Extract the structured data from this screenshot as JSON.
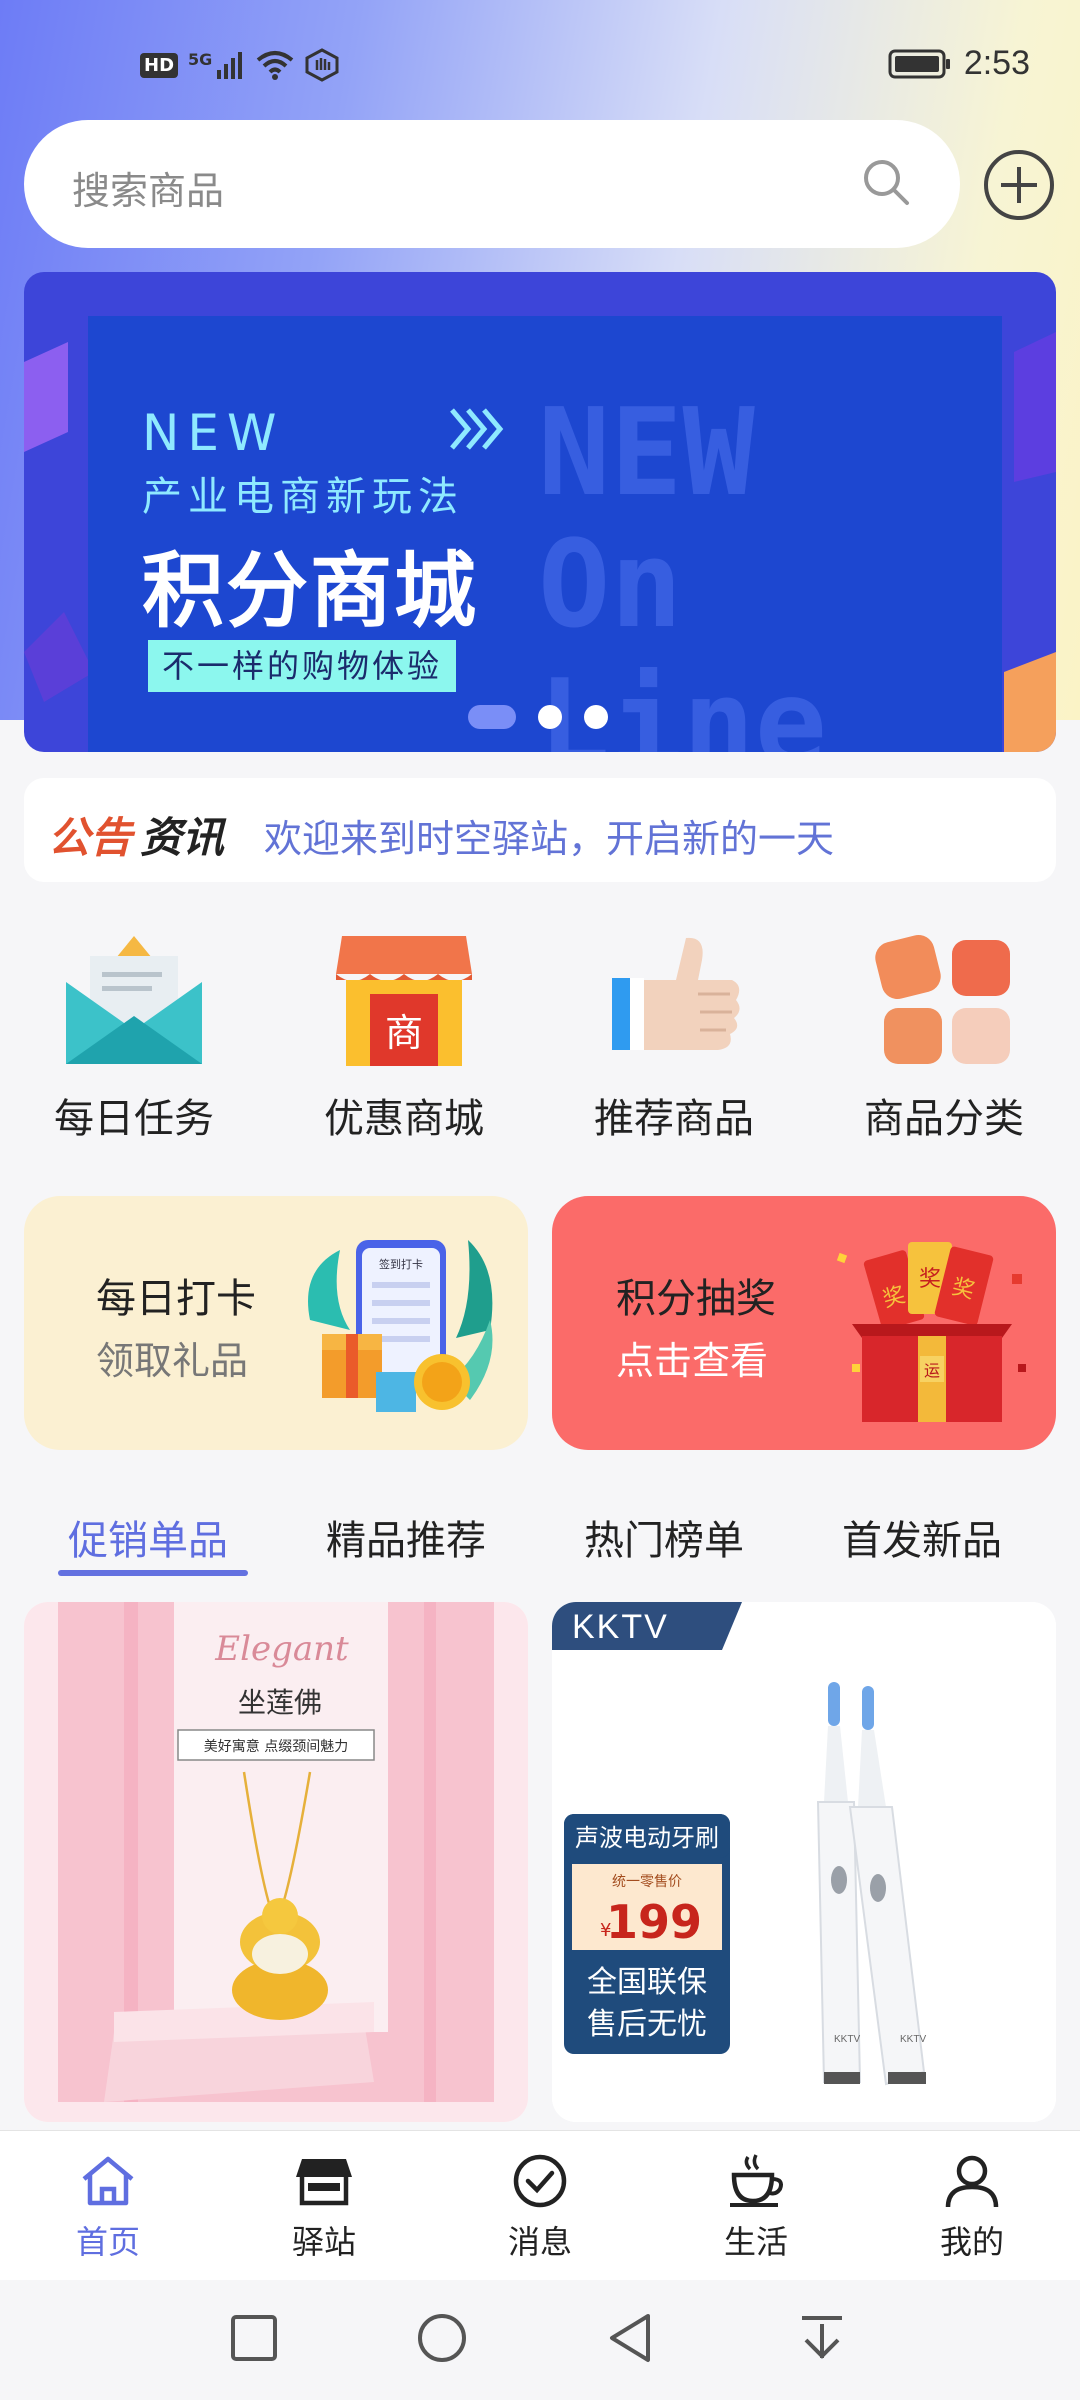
{
  "status_bar": {
    "hd": "HD",
    "network": "5G",
    "time": "2:53"
  },
  "search": {
    "placeholder": "搜索商品"
  },
  "banner": {
    "new_label": "NEW",
    "subtitle": "产业电商新玩法",
    "title": "积分商城",
    "tagline": "不一样的购物体验",
    "bg_text_1": "NEW",
    "bg_text_2": "On Line",
    "slide_index": 1,
    "slide_count": 3
  },
  "notice": {
    "label_a": "公告",
    "label_b": "资讯",
    "text": "欢迎来到时空驿站，开启新的一天"
  },
  "quick_links": [
    {
      "label": "每日任务",
      "icon": "envelope-icon"
    },
    {
      "label": "优惠商城",
      "icon": "shop-icon",
      "icon_text": "商"
    },
    {
      "label": "推荐商品",
      "icon": "thumbs-up-icon"
    },
    {
      "label": "商品分类",
      "icon": "category-grid-icon"
    }
  ],
  "promos": {
    "checkin": {
      "title": "每日打卡",
      "subtitle": "领取礼品",
      "phone_text": "签到打卡"
    },
    "lottery": {
      "title": "积分抽奖",
      "subtitle": "点击查看",
      "prize_text": "奖",
      "box_text": "运"
    }
  },
  "tabs": [
    "促销单品",
    "精品推荐",
    "热门榜单",
    "首发新品"
  ],
  "active_tab": 0,
  "products": [
    {
      "script": "Elegant",
      "name": "坐莲佛",
      "slogan": "美好寓意 点缀颈间魅力"
    },
    {
      "brand": "KKTV",
      "title": "声波电动牙刷",
      "price_label": "统一零售价",
      "currency": "¥",
      "price": "199",
      "line1": "全国联保",
      "line2": "售后无忧",
      "handle_text": "KKTV"
    }
  ],
  "bottom_nav": [
    {
      "label": "首页",
      "icon": "home-icon",
      "active": true
    },
    {
      "label": "驿站",
      "icon": "store-icon",
      "active": false
    },
    {
      "label": "消息",
      "icon": "message-check-icon",
      "active": false
    },
    {
      "label": "生活",
      "icon": "coffee-cup-icon",
      "active": false
    },
    {
      "label": "我的",
      "icon": "person-icon",
      "active": false
    }
  ],
  "colors": {
    "accent": "#5f6ee0",
    "notice_red": "#e1522f",
    "lottery_bg": "#fb6b69",
    "checkin_bg": "#fbf0d2"
  }
}
